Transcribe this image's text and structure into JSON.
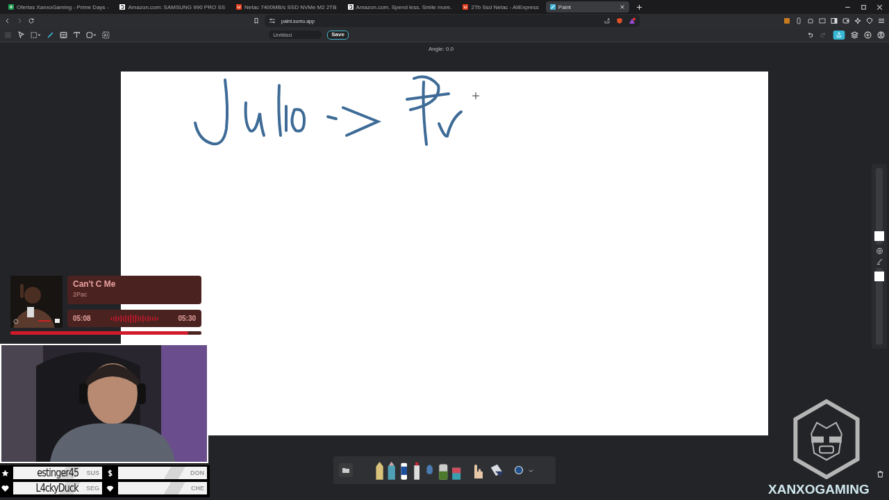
{
  "browser": {
    "tabs": [
      {
        "kind": "sheet",
        "label": "Ofertas XanxoGaming - Prime Days -",
        "selected": false
      },
      {
        "kind": "store",
        "label": "Amazon.com: SAMSUNG 990 PRO SS",
        "selected": false
      },
      {
        "kind": "shop",
        "label": "Netac 7400MB/s SSD NVMe M2 2TB",
        "selected": false
      },
      {
        "kind": "store",
        "label": "Amazon.com. Spend less. Smile more.",
        "selected": false
      },
      {
        "kind": "shop",
        "label": "2Tb Ssd Netac - AliExpress",
        "selected": false
      },
      {
        "kind": "paint",
        "label": "Paint",
        "selected": true
      }
    ],
    "address": "paint.sumo.app"
  },
  "app": {
    "title_field": "Untitled",
    "save": "Save",
    "angle": "Angle: 0.0"
  },
  "side_sliders": [
    {
      "level": 0.05
    },
    {
      "level": 0.95
    }
  ],
  "music": {
    "title": "Can't C Me",
    "artist": "2Pac",
    "elapsed": "05:08",
    "duration": "05:30",
    "level": 0.93
  },
  "ticker": [
    {
      "kind": "star",
      "name": "estinger45",
      "tag": "SUS"
    },
    {
      "kind": "dollar",
      "tag": "DON"
    },
    {
      "kind": "heart",
      "name": "L4ckyDuck",
      "tag": "SEG"
    },
    {
      "kind": "gem",
      "tag": "CHE"
    }
  ],
  "brand": "XANXOGAMING"
}
